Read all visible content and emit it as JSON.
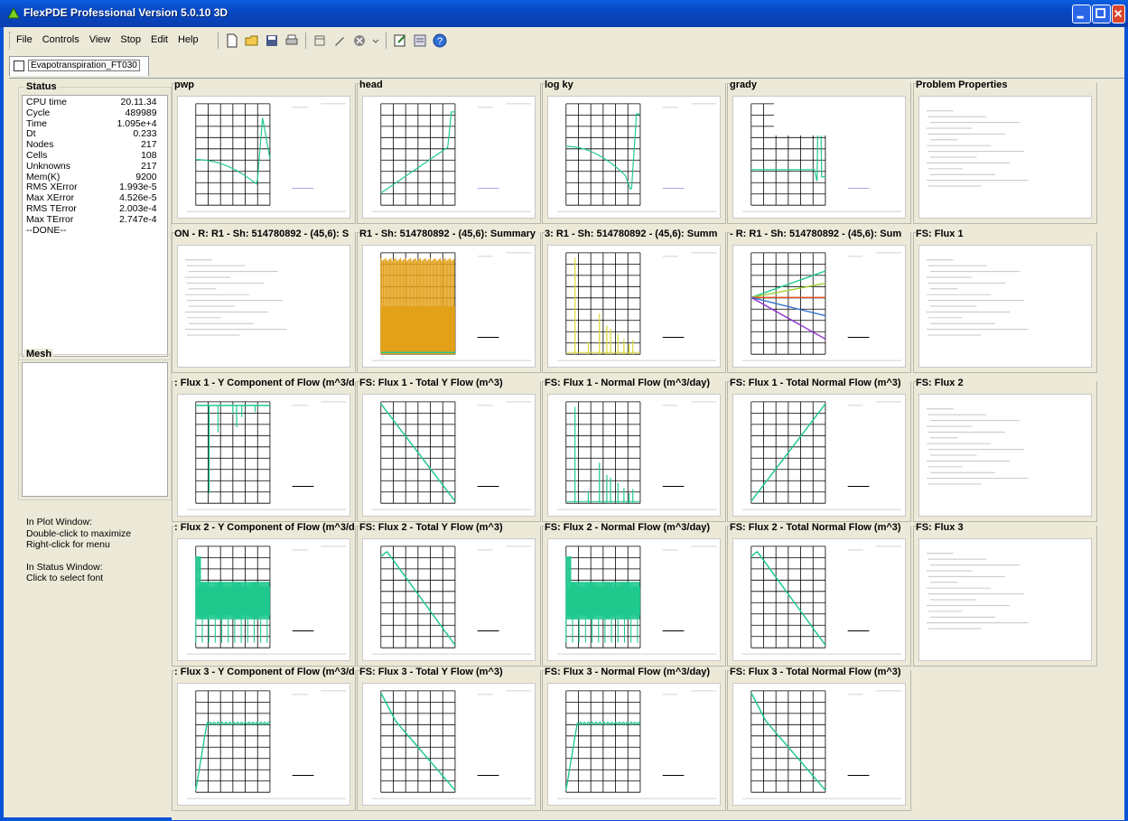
{
  "window": {
    "title": "FlexPDE Professional Version 5.0.10 3D"
  },
  "menu": [
    "File",
    "Controls",
    "View",
    "Stop",
    "Edit",
    "Help"
  ],
  "toolbar_icons": [
    "new-icon",
    "open-icon",
    "save-icon",
    "print-icon",
    "window-icon",
    "pen-icon",
    "stop-icon",
    "dropdown-icon",
    "edit-icon",
    "list-icon",
    "help-icon"
  ],
  "tab": {
    "label": "Evapotranspiration_FT030"
  },
  "status": {
    "title": "Status",
    "rows": [
      {
        "label": "CPU time",
        "value": "20.11.34"
      },
      {
        "label": "Cycle",
        "value": "489989"
      },
      {
        "label": "Time",
        "value": "1.095e+4"
      },
      {
        "label": "Dt",
        "value": "0.233"
      },
      {
        "label": "Nodes",
        "value": "217"
      },
      {
        "label": "Cells",
        "value": "108"
      },
      {
        "label": "Unknowns",
        "value": "217"
      },
      {
        "label": "Mem(K)",
        "value": "9200"
      },
      {
        "label": "RMS XError",
        "value": "1.993e-5"
      },
      {
        "label": "Max XError",
        "value": "4.526e-5"
      },
      {
        "label": "RMS TError",
        "value": "2.003e-4"
      },
      {
        "label": "Max TError",
        "value": "2.747e-4"
      },
      {
        "label": "--DONE--",
        "value": ""
      }
    ]
  },
  "mesh": {
    "title": "Mesh"
  },
  "help": {
    "line1": "In Plot Window:",
    "line2": "Double-click to maximize",
    "line3": "Right-click for menu",
    "line4": "In Status Window:",
    "line5": "Click to select font"
  },
  "plots": [
    {
      "title": "pwp",
      "kind": "pwp"
    },
    {
      "title": "head",
      "kind": "head"
    },
    {
      "title": "log ky",
      "kind": "logky"
    },
    {
      "title": "grady",
      "kind": "grady"
    },
    {
      "title": "Problem Properties",
      "kind": "text"
    },
    {
      "title": "ON - R: R1 - Sh: 514780892 - (45,6): S",
      "kind": "text"
    },
    {
      "title": "R1 - Sh: 514780892 - (45,6): Summary",
      "kind": "orange"
    },
    {
      "title": "3: R1 - Sh: 514780892 - (45,6): Summ",
      "kind": "spikes"
    },
    {
      "title": "- R: R1 - Sh: 514780892 - (45,6): Sum",
      "kind": "fan"
    },
    {
      "title": "FS: Flux 1",
      "kind": "text"
    },
    {
      "title": ": Flux 1 - Y Component of Flow (m^3/d",
      "kind": "ycomp1"
    },
    {
      "title": "FS: Flux 1 - Total Y Flow (m^3)",
      "kind": "down"
    },
    {
      "title": "FS: Flux 1 - Normal Flow (m^3/day)",
      "kind": "spikesteal"
    },
    {
      "title": "FS: Flux 1 - Total Normal Flow (m^3)",
      "kind": "up"
    },
    {
      "title": "FS: Flux 2",
      "kind": "text"
    },
    {
      "title": ": Flux 2 - Y Component of Flow (m^3/d",
      "kind": "dense"
    },
    {
      "title": "FS: Flux 2 - Total Y Flow (m^3)",
      "kind": "humpdown"
    },
    {
      "title": "FS: Flux 2 - Normal Flow (m^3/day)",
      "kind": "dense"
    },
    {
      "title": "FS: Flux 2 - Total Normal Flow (m^3)",
      "kind": "humpdown"
    },
    {
      "title": "FS: Flux 3",
      "kind": "text"
    },
    {
      "title": ": Flux 3 - Y Component of Flow (m^3/d",
      "kind": "rise"
    },
    {
      "title": "FS: Flux 3 - Total Y Flow (m^3)",
      "kind": "down2"
    },
    {
      "title": "FS: Flux 3 - Normal Flow (m^3/day)",
      "kind": "rise"
    },
    {
      "title": "FS: Flux 3 - Total Normal Flow (m^3)",
      "kind": "down2"
    }
  ],
  "colors": {
    "teal": "#1fc98e",
    "orange": "#e3a11a",
    "grid": "#000000",
    "titlebar": "#0a52d8"
  }
}
